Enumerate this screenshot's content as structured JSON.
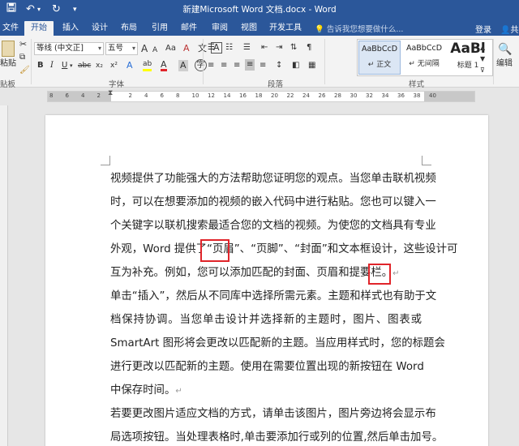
{
  "window": {
    "title": "新建Microsoft Word 文档.docx - Word"
  },
  "quick_access": {
    "save_icon": "save-icon",
    "undo_icon": "undo-icon",
    "redo_icon": "redo-icon",
    "customize_icon": "dropdown-icon"
  },
  "tabs": [
    "文件",
    "开始",
    "插入",
    "设计",
    "布局",
    "引用",
    "邮件",
    "审阅",
    "视图",
    "开发工具"
  ],
  "tell_me": "告诉我您想要做什么...",
  "signin": "登录",
  "share": "共",
  "ribbon": {
    "clipboard": {
      "paste": "粘贴",
      "label": "贴板"
    },
    "font": {
      "name": "等线 (中文正]",
      "size": "五号",
      "grow": "A",
      "shrink": "A",
      "case": "Aa",
      "clear": "A",
      "phonetic": "文",
      "border_char": "A",
      "bold": "B",
      "italic": "I",
      "underline": "U",
      "strike": "abc",
      "sub": "x₂",
      "sup": "x²",
      "effects": "A",
      "highlight": "ab",
      "color": "A",
      "shade": "A",
      "enclose": "字",
      "label": "字体"
    },
    "paragraph": {
      "label": "段落"
    },
    "styles": {
      "items": [
        {
          "preview": "AaBbCcD",
          "name": "正文"
        },
        {
          "preview": "AaBbCcD",
          "name": "无间隔"
        },
        {
          "preview": "AaBl",
          "name": "标题 1"
        }
      ],
      "label": "样式"
    },
    "editing": {
      "label": "编辑"
    }
  },
  "ruler": {
    "numbers": [
      "8",
      "6",
      "4",
      "2",
      "",
      "2",
      "4",
      "6",
      "8",
      "10",
      "12",
      "14",
      "16",
      "18",
      "20",
      "22",
      "24",
      "26",
      "28",
      "30",
      "32",
      "34",
      "36",
      "38",
      "40"
    ]
  },
  "document": {
    "lines": [
      "视频提供了功能强大的方法帮助您证明您的观点。当您单击联机视频",
      "时，可以在想要添加的视频的嵌入代码中进行粘贴。您也可以键入一",
      "个关键字以联机搜索最适合您的文档的视频。为使您的文档具有专业",
      "外观，Word 提供了“页眉”、“页脚”、“封面”和文本框设计，这些设计可",
      "互为补充。例如，您可以添加匹配的封面、页眉和提要栏。",
      "单击“插入”，然后从不同库中选择所需元素。主题和样式也有助于文",
      "档保持协调。当您单击设计并选择新的主题时，图片、图表或",
      "SmartArt 图形将会更改以匹配新的主题。当应用样式时，您的标题会",
      "进行更改以匹配新的主题。使用在需要位置出现的新按钮在 Word",
      "中保存时间。",
      "若要更改图片适应文档的方式，请单击该图片，图片旁边将会显示布",
      "局选项按钮。当处理表格时,单击要添加行或列的位置,然后单击加号。"
    ],
    "paragraph_mark": "↵"
  }
}
